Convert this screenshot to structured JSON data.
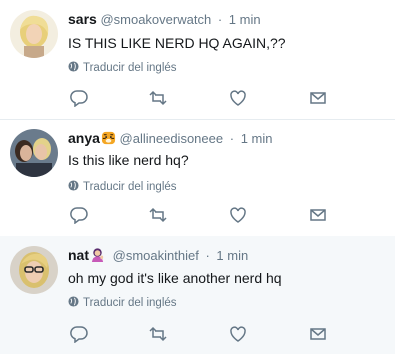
{
  "tweets": [
    {
      "name": "sars",
      "handle": "@smoakoverwatch",
      "separator": "·",
      "time": "1 min",
      "text": "IS THIS LIKE NERD HQ AGAIN,??",
      "translate_label": "Traducir del inglés",
      "avatar_icon": "avatar-blonde-woman",
      "highlighted": false
    },
    {
      "name": "anya",
      "name_emoji": "tiger-face-emoji",
      "handle": "@allineedisoneee",
      "separator": "·",
      "time": "1 min",
      "text": "Is this like nerd hq?",
      "translate_label": "Traducir del inglés",
      "avatar_icon": "avatar-couple-photo",
      "highlighted": false
    },
    {
      "name": "nat",
      "name_emoji": "woman-tipping-hand-emoji",
      "handle": "@smoakinthief",
      "separator": "·",
      "time": "1 min",
      "text": "oh my god it's like another nerd hq",
      "translate_label": "Traducir del inglés",
      "avatar_icon": "avatar-woman-glasses",
      "highlighted": true
    }
  ],
  "action_icons": [
    "reply-icon",
    "retweet-icon",
    "like-icon",
    "direct-message-icon"
  ],
  "colors": {
    "muted": "#657786",
    "text": "#14171a",
    "divider": "#e6ecf0",
    "highlight_bg": "#f5f8fa"
  }
}
